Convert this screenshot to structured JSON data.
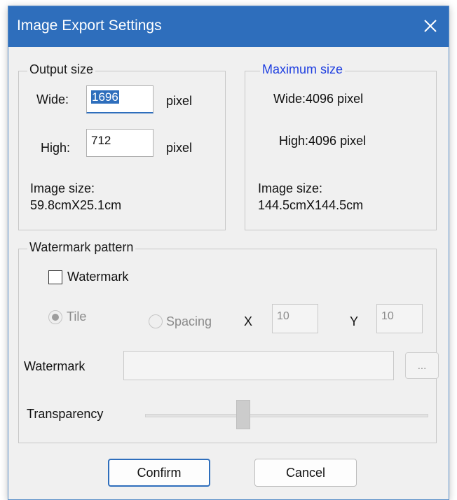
{
  "window": {
    "title": "Image Export Settings",
    "close_icon": "close-icon"
  },
  "output_size": {
    "legend": "Output size",
    "wide_label": "Wide:",
    "wide_value": "1696",
    "high_label": "High:",
    "high_value": "712",
    "unit": "pixel",
    "image_size_label": "Image size:",
    "image_size_value": "59.8cmX25.1cm"
  },
  "maximum_size": {
    "legend": "Maximum size",
    "legend_color": "#2040e0",
    "wide": "Wide:4096 pixel",
    "high": "High:4096 pixel",
    "image_size_label": "Image size:",
    "image_size_value": "144.5cmX144.5cm"
  },
  "watermark": {
    "legend": "Watermark pattern",
    "checkbox_label": "Watermark",
    "checked": false,
    "tile_label": "Tile",
    "spacing_label": "Spacing",
    "x_label": "X",
    "x_value": "10",
    "y_label": "Y",
    "y_value": "10",
    "file_label": "Watermark",
    "file_value": "",
    "browse_label": "...",
    "transparency_label": "Transparency",
    "transparency_level": 0.35
  },
  "buttons": {
    "confirm": "Confirm",
    "cancel": "Cancel"
  },
  "colors": {
    "titlebar": "#2e6ebc",
    "accent": "#2e6ebc",
    "background": "#f0f0f0"
  }
}
